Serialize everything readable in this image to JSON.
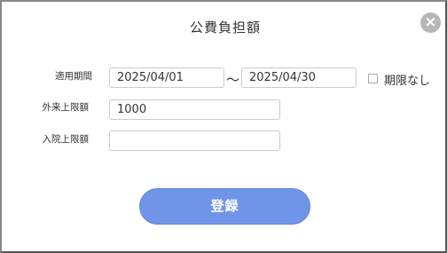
{
  "dialog": {
    "title": "公費負担額",
    "close_icon": "×"
  },
  "form": {
    "period_label": "適用期間",
    "start_date": "2025/04/01",
    "separator": "〜",
    "end_date": "2025/04/30",
    "no_limit_label": "期限なし",
    "no_limit_checked": false,
    "outpatient_label": "外来上限額",
    "outpatient_value": "1000",
    "inpatient_label": "入院上限額",
    "inpatient_value": ""
  },
  "actions": {
    "submit_label": "登録"
  },
  "colors": {
    "accent": "#7095e8",
    "close_bg": "#b7b7b7"
  }
}
